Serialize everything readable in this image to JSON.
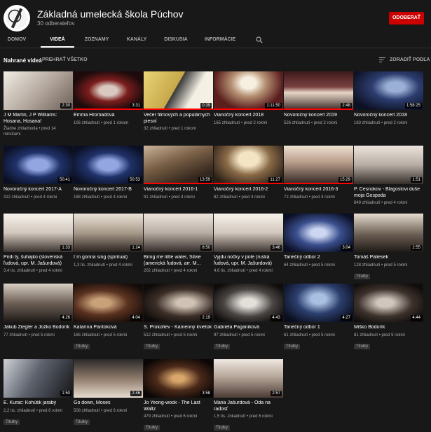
{
  "channel": {
    "name": "Základná umelecká škola Púchov",
    "subscribers": "30 odberateľov",
    "subscribe_label": "ODOBERAŤ",
    "brand_color": "#cc0000"
  },
  "tabs": [
    "DOMOV",
    "VIDEÁ",
    "ZOZNAMY",
    "KANÁLY",
    "DISKUSIA",
    "INFORMÁCIE"
  ],
  "active_tab": "VIDEÁ",
  "section": {
    "title": "Nahrané videá",
    "play_all": "PREHRAŤ VŠETKO",
    "sort_label": "ZORADIŤ PODĽA"
  },
  "videos": [
    {
      "title": "J M Martin, J P Williams: Hosana, Hosana!",
      "duration": "2:30",
      "views": "Žiadne zhliadnutia",
      "age": "pred 14 minútami",
      "progress": 0
    },
    {
      "title": "Emma Hromadová",
      "duration": "3:31",
      "views": "106 zhliadnutí",
      "age": "pred 1 rokom",
      "progress": 1
    },
    {
      "title": "Večer filmových a populárnych piesní",
      "duration": "0:39",
      "views": "32 zhliadnutí",
      "age": "pred 1 rokom",
      "progress": 1
    },
    {
      "title": "Vianočný koncert 2018",
      "duration": "1:11:50",
      "views": "165 zhliadnutí",
      "age": "pred 2 rokmi",
      "progress": 1
    },
    {
      "title": "Novoročný koncert 2019",
      "duration": "2:48",
      "views": "526 zhliadnutí",
      "age": "pred 2 rokmi",
      "progress": 1
    },
    {
      "title": "Novoročný koncert 2018",
      "duration": "1:58:25",
      "views": "183 zhliadnutí",
      "age": "pred 2 rokmi",
      "progress": 0
    },
    {
      "title": "Novoročný koncert 2017-A",
      "duration": "50:41",
      "views": "312 zhliadnutí",
      "age": "pred 4 rokmi",
      "progress": 0
    },
    {
      "title": "Novoročný koncert 2017-B",
      "duration": "50:53",
      "views": "188 zhliadnutí",
      "age": "pred 4 rokmi",
      "progress": 0
    },
    {
      "title": "Vianočný koncert 2016-1",
      "duration": "13:59",
      "views": "91 zhliadnutí",
      "age": "pred 4 rokmi",
      "progress": 1
    },
    {
      "title": "Vianočný koncert 2016-2",
      "duration": "11:27",
      "views": "82 zhliadnutí",
      "age": "pred 4 rokmi",
      "progress": 1
    },
    {
      "title": "Vianočný koncert 2016-3",
      "duration": "15:29",
      "views": "72 zhliadnutí",
      "age": "pred 4 rokmi",
      "progress": 1
    },
    {
      "title": "P. Česnokov - Blagoslovi duše moja Gospoda",
      "duration": "1:51",
      "views": "849 zhliadnutí",
      "age": "pred 4 rokmi",
      "progress": 0
    },
    {
      "title": "Pridi ty, šuhajko (slovenská ľudová, upr. M. Jašurdová)",
      "duration": "1:33",
      "views": "3,4 tis. zhliadnutí",
      "age": "pred 4 rokmi",
      "progress": 0
    },
    {
      "title": "I´m gonna sing (spiritual)",
      "duration": "1:24",
      "views": "1,3 tis. zhliadnutí",
      "age": "pred 4 rokmi",
      "progress": 0
    },
    {
      "title": "Bring me little water, Silvie (americká ľudová, arr. M...",
      "duration": "8:50",
      "views": "202 zhliadnutí",
      "age": "pred 4 rokmi",
      "progress": 0
    },
    {
      "title": "Vyjdu nočky v pole (ruská ľudová, upr. M. Jašurdová)",
      "duration": "3:46",
      "views": "4,6 tis. zhliadnutí",
      "age": "pred 4 rokmi",
      "progress": 0
    },
    {
      "title": "Tanečný odbor 2",
      "duration": "3:04",
      "views": "64 zhliadnutí",
      "age": "pred 5 rokmi",
      "progress": 0
    },
    {
      "title": "Tomáš Paliesek",
      "duration": "2:55",
      "views": "128 zhliadnutí",
      "age": "pred 5 rokmi",
      "badge": "Titulky",
      "progress": 0
    },
    {
      "title": "Jakub Ziegler a Jožko Bodorík",
      "duration": "4:26",
      "views": "77 zhliadnutí",
      "age": "pred 5 rokmi",
      "progress": 0
    },
    {
      "title": "Katarína Pantoková",
      "duration": "4:04",
      "views": "165 zhliadnutí",
      "age": "pred 5 rokmi",
      "badge": "Titulky",
      "progress": 0
    },
    {
      "title": "S. Prokofiev - Kamenný kvietok",
      "duration": "2:19",
      "views": "512 zhliadnutí",
      "age": "pred 5 rokmi",
      "badge": "Titulky",
      "progress": 0
    },
    {
      "title": "Gabriela Paganiková",
      "duration": "4:43",
      "views": "97 zhliadnutí",
      "age": "pred 5 rokmi",
      "badge": "Titulky",
      "progress": 0
    },
    {
      "title": "Tanečný odbor 1",
      "duration": "4:27",
      "views": "61 zhliadnutí",
      "age": "pred 5 rokmi",
      "badge": "Titulky",
      "progress": 0
    },
    {
      "title": "Miško Bodorík",
      "duration": "4:44",
      "views": "81 zhliadnutí",
      "age": "pred 5 rokmi",
      "badge": "Titulky",
      "progress": 0
    },
    {
      "title": "E. Kurac: Kohútik jarabý",
      "duration": "1:50",
      "views": "2,2 tis. zhliadnutí",
      "age": "pred 6 rokmi",
      "badge": "Titulky",
      "progress": 0
    },
    {
      "title": "Go down, Moses",
      "duration": "2:46",
      "views": "508 zhliadnutí",
      "age": "pred 6 rokmi",
      "badge": "Titulky",
      "progress": 0
    },
    {
      "title": "Jo Yeong-wook - The Last Waltz",
      "duration": "3:58",
      "views": "479 zhliadnutí",
      "age": "pred 6 rokmi",
      "badge": "Titulky",
      "progress": 0
    },
    {
      "title": "Mária Jašurdová - Óda na radosť",
      "duration": "2:57",
      "views": "1,5 tis. zhliadnutí",
      "age": "pred 6 rokmi",
      "badge": "Titulky",
      "progress": 0
    }
  ]
}
